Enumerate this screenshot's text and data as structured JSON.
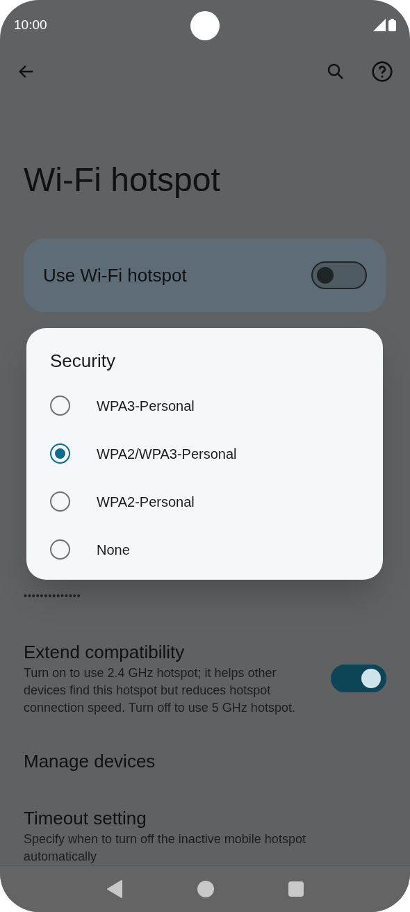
{
  "status_bar": {
    "time": "10:00"
  },
  "page": {
    "title": "Wi-Fi hotspot",
    "main_switch": {
      "label": "Use Wi-Fi hotspot",
      "on": false
    }
  },
  "hidden_rows": {
    "password_value": "••••••••••••••"
  },
  "settings": [
    {
      "kind": "switch",
      "title": "Extend compatibility",
      "summary": "Turn on to use 2.4 GHz hotspot; it helps other devices find this hotspot but reduces hotspot connection speed. Turn off to use 5 GHz hotspot.",
      "on": true
    },
    {
      "kind": "link",
      "title": "Manage devices"
    },
    {
      "kind": "link",
      "title": "Timeout setting",
      "summary": "Specify when to turn off the inactive mobile hotspot automatically"
    }
  ],
  "dialog": {
    "title": "Security",
    "options": [
      {
        "label": "WPA3-Personal",
        "selected": false
      },
      {
        "label": "WPA2/WPA3-Personal",
        "selected": true
      },
      {
        "label": "WPA2-Personal",
        "selected": false
      },
      {
        "label": "None",
        "selected": false
      }
    ]
  }
}
